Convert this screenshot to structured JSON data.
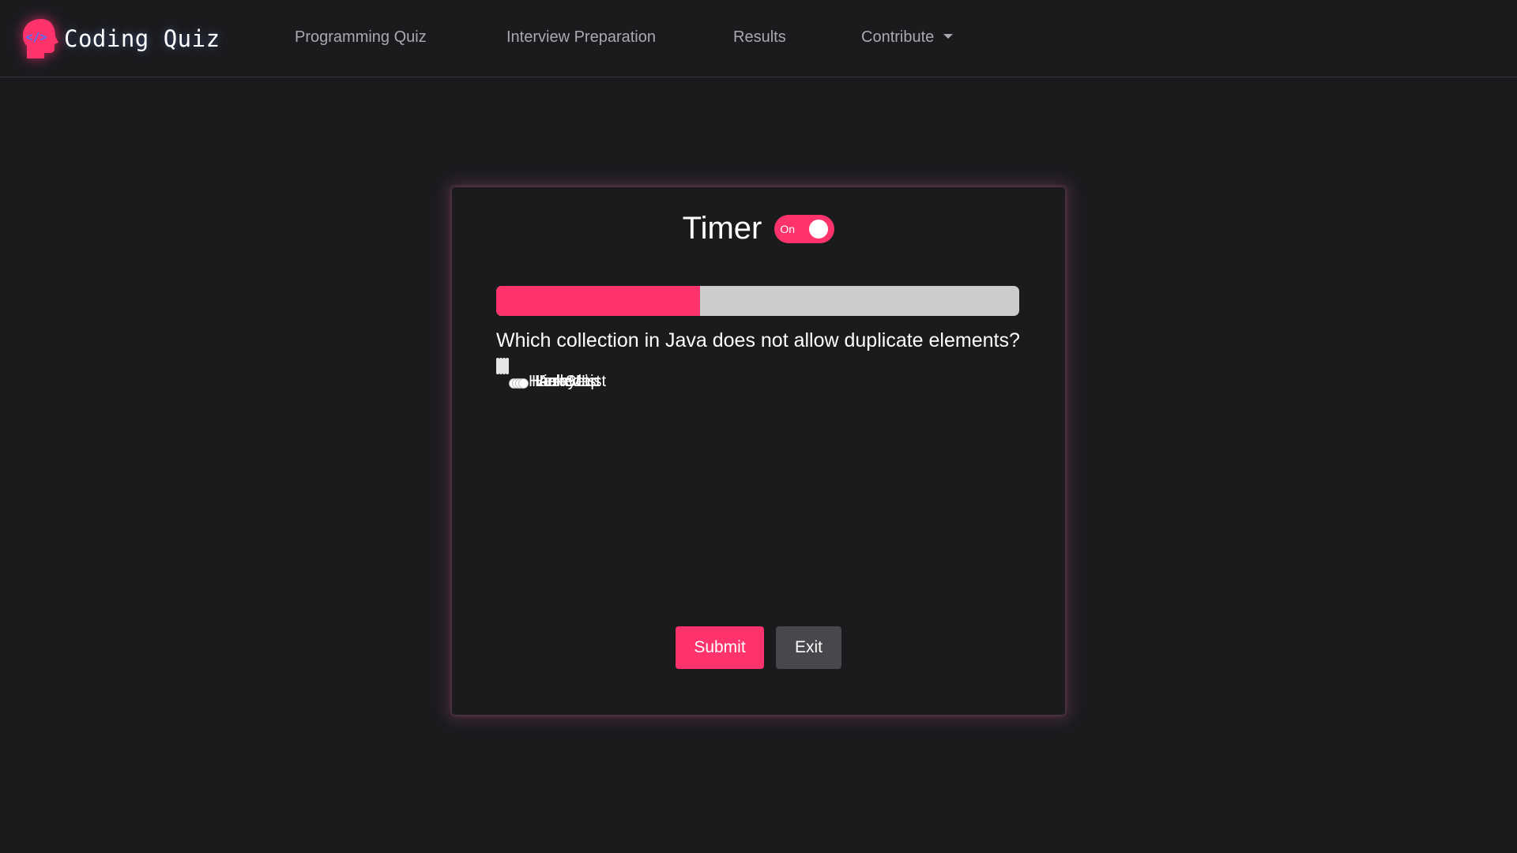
{
  "brand": {
    "name": "Coding Quiz",
    "logo_icon": "head-code-icon",
    "accent_color": "#ff336b"
  },
  "nav": {
    "items": [
      {
        "label": "Programming Quiz"
      },
      {
        "label": "Interview Preparation"
      },
      {
        "label": "Results"
      },
      {
        "label": "Contribute"
      }
    ]
  },
  "quiz": {
    "timer_label": "Timer",
    "timer_toggle": {
      "state_text": "On",
      "enabled": true
    },
    "progress_percent": 39,
    "question": "Which collection in Java does not allow duplicate elements?",
    "options": [
      {
        "label": "HashSet",
        "selected": false
      },
      {
        "label": "HashMap",
        "selected": false
      },
      {
        "label": "LinkedList",
        "selected": false
      },
      {
        "label": "ArrayList",
        "selected": false
      }
    ],
    "submit_label": "Submit",
    "exit_label": "Exit"
  },
  "colors": {
    "background": "#1b1b1e",
    "accent": "#ff336b",
    "progress_track": "#cccccc",
    "exit_button": "#48484c"
  }
}
